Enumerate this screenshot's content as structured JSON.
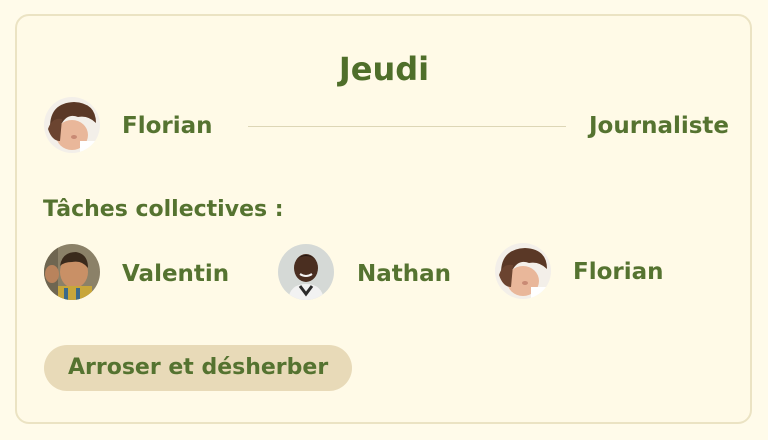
{
  "day": "Jeudi",
  "assignment": {
    "person": "Florian",
    "role": "Journaliste",
    "avatar_icon": "child-photo-avatar"
  },
  "collective": {
    "title": "Tâches collectives :",
    "members": [
      {
        "name": "Valentin",
        "avatar_icon": "child-photo-avatar"
      },
      {
        "name": "Nathan",
        "avatar_icon": "child-photo-avatar"
      },
      {
        "name": "Florian",
        "avatar_icon": "child-photo-avatar"
      }
    ],
    "task": "Arroser et désherber"
  },
  "colors": {
    "background": "#fffbea",
    "text": "#557330",
    "chip": "#e8dab8",
    "border": "#ebe3c3"
  }
}
